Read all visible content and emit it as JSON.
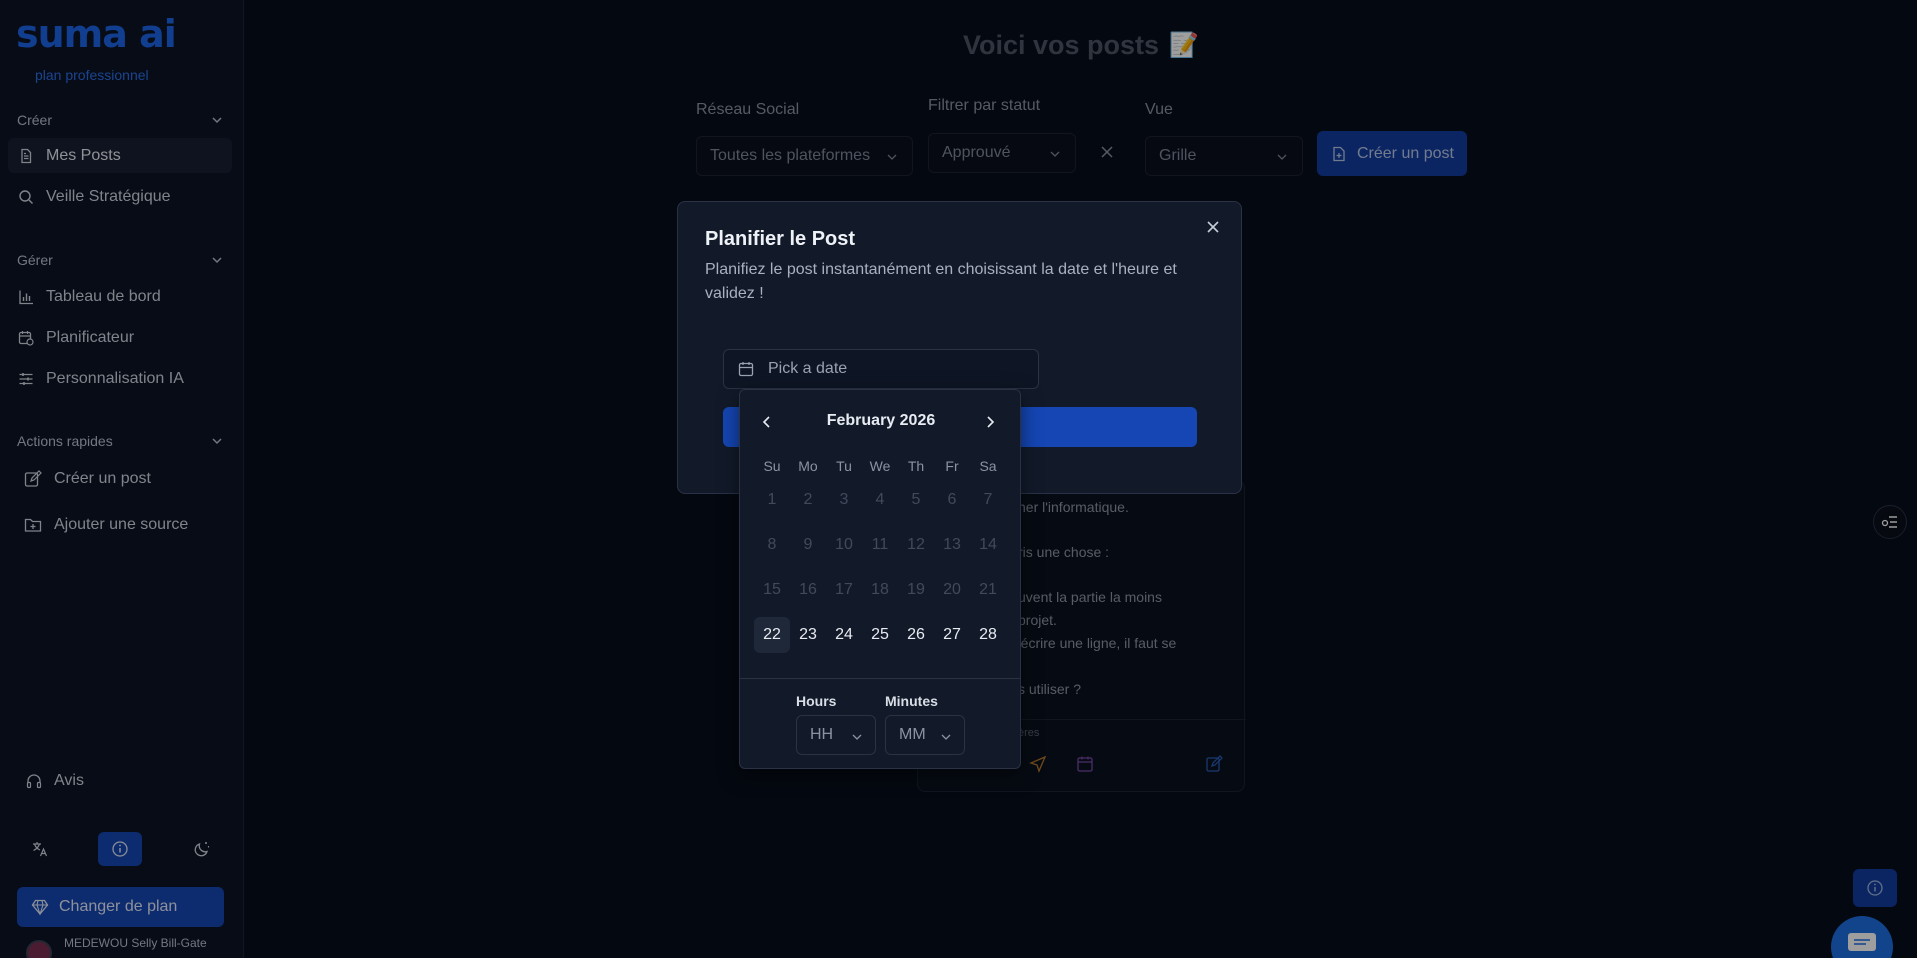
{
  "brand": {
    "logo_text": "suma ai",
    "plan_label": "plan professionnel"
  },
  "sidebar": {
    "section_create": "Créer",
    "nav_posts": "Mes Posts",
    "nav_watch": "Veille Stratégique",
    "section_manage": "Gérer",
    "nav_dashboard": "Tableau de bord",
    "nav_planner": "Planificateur",
    "nav_ai": "Personnalisation IA",
    "section_quick": "Actions rapides",
    "quick_create": "Créer un post",
    "quick_source": "Ajouter une source",
    "reviews": "Avis",
    "change_plan": "Changer de plan",
    "user_name": "MEDEWOU Selly Bill-Gate"
  },
  "main": {
    "title": "Voici vos posts",
    "title_emoji": "📝",
    "filter_network_label": "Réseau Social",
    "filter_network_value": "Toutes les plateformes",
    "filter_status_label": "Filtrer par statut",
    "filter_status_value": "Approuvé",
    "view_label": "Vue",
    "view_value": "Grille",
    "create_post": "Créer un post"
  },
  "post_card": {
    "lines": [
      "ner l'informatique.",
      "ris une chose :",
      "uvent la partie la moins",
      "projet.",
      "'écrire une ligne, il faut se",
      "s utiliser ?"
    ],
    "footer_text": "ères"
  },
  "modal": {
    "title": "Planifier le Post",
    "description": "Planifiez le post instantanément en choisissant la date et l'heure et validez !",
    "date_placeholder": "Pick a date"
  },
  "calendar": {
    "month_label": "February 2026",
    "weekdays": [
      "Su",
      "Mo",
      "Tu",
      "We",
      "Th",
      "Fr",
      "Sa"
    ],
    "days": [
      "1",
      "2",
      "3",
      "4",
      "5",
      "6",
      "7",
      "8",
      "9",
      "10",
      "11",
      "12",
      "13",
      "14",
      "15",
      "16",
      "17",
      "18",
      "19",
      "20",
      "21",
      "22",
      "23",
      "24",
      "25",
      "26",
      "27",
      "28"
    ],
    "first_enabled_day": 22,
    "today": 22,
    "hours_label": "Hours",
    "hours_placeholder": "HH",
    "minutes_label": "Minutes",
    "minutes_placeholder": "MM"
  },
  "colors": {
    "accent": "#1546b4",
    "background": "#070d1b",
    "sidebar": "#0c1425",
    "modal": "#121a2a"
  }
}
